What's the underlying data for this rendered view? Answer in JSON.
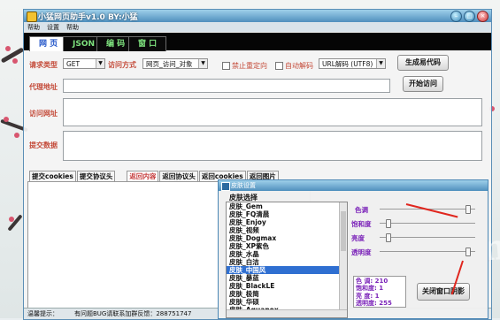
{
  "app": {
    "title": "小猛网页助手v1.0 BY:小猛",
    "menu": [
      "帮助",
      "设置",
      "帮助"
    ]
  },
  "tabs": [
    {
      "label": "网 页"
    },
    {
      "label": "JSON"
    },
    {
      "label": "编 码"
    },
    {
      "label": "窗 口"
    }
  ],
  "request": {
    "type_label": "请求类型",
    "type_value": "GET",
    "access_label": "访问方式",
    "access_value": "网页_访问_对象",
    "redirect_label": "禁止重定向",
    "autodecode_label": "自动解码",
    "url_decode_value": "URL解码 (UTF8)",
    "proxy_label": "代理地址",
    "url_label": "访问网址",
    "post_label": "提交数据",
    "gen_code_button": "生成易代码",
    "start_button": "开始访问"
  },
  "bottom_tabs": [
    "提交cookies",
    "提交协议头",
    "返回内容",
    "返回协议头",
    "返回cookies",
    "返回图片"
  ],
  "status": {
    "label": "温馨提示：",
    "message": "有问题BUG请联系加群反馈：288751747"
  },
  "skin_dialog": {
    "title": "皮肤设置",
    "list_header": "皮肤选择",
    "skins": [
      "皮肤_Gem",
      "皮肤_FQ清晨",
      "皮肤_Enjoy",
      "皮肤_视频",
      "皮肤_Dogmax",
      "皮肤_XP紫色",
      "皮肤_水晶",
      "皮肤_白洁",
      "皮肤_中国风",
      "皮肤_暴蓝",
      "皮肤_BlackLE",
      "皮肤_极简",
      "皮肤_华硕",
      "皮肤_Aquanox"
    ],
    "selected_index": 8,
    "sliders": [
      {
        "label": "色调",
        "value": 0.92
      },
      {
        "label": "饱和度",
        "value": 0.08
      },
      {
        "label": "亮度",
        "value": 0.08
      },
      {
        "label": "透明度",
        "value": 0.92
      }
    ],
    "info": {
      "hue": "色 调: 210",
      "sat": "饱和度: 1",
      "bright": "亮 度: 1",
      "alpha": "透明度: 255"
    },
    "close_shadow_button": "关闭窗口阴影"
  },
  "watermark": "WWW.9gxyun.com",
  "colors": {
    "accent": "#2356c9",
    "label_red": "#c44b3a",
    "tab_green": "#7ee27e",
    "purple_info": "#7a22b8"
  }
}
